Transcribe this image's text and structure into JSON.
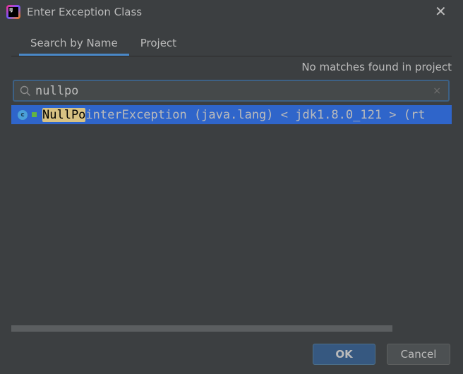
{
  "window": {
    "title": "Enter Exception Class",
    "logo_text": "IJ"
  },
  "tabs": [
    {
      "label": "Search by Name",
      "active": true
    },
    {
      "label": "Project",
      "active": false
    }
  ],
  "status": "No matches found in project",
  "search": {
    "value": "nullpo",
    "clear": "×"
  },
  "results": [
    {
      "icon": "class-icon",
      "icon_letter": "c",
      "match": "NullPo",
      "rest": "interException (java.lang) < jdk1.8.0_121 > (rt"
    }
  ],
  "buttons": {
    "ok": "OK",
    "cancel": "Cancel"
  },
  "close": "✕"
}
